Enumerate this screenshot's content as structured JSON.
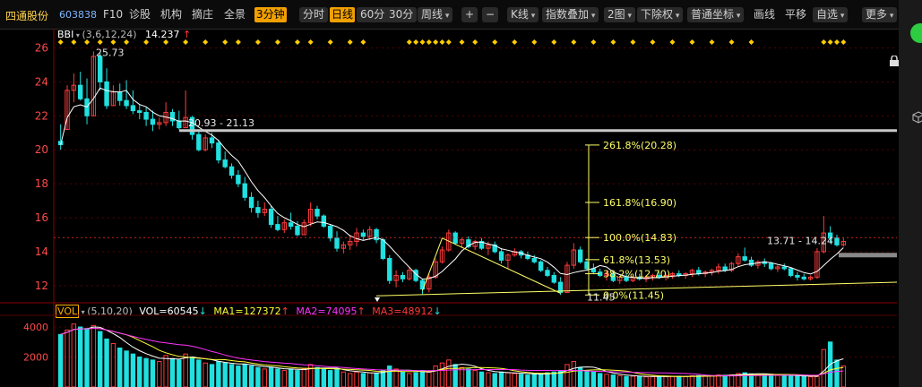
{
  "stock": {
    "name": "四通股份",
    "code": "603838"
  },
  "toolbar": {
    "left_items": [
      "F10",
      "诊股",
      "机构",
      "摘庄",
      "全景",
      "3分钟"
    ],
    "period_items": [
      "分时",
      "日线",
      "60分",
      "30分",
      "周线"
    ],
    "right_items": [
      "K线",
      "指数叠加",
      "2图",
      "下除权",
      "普通坐标",
      "画线",
      "平移",
      "自选",
      "更多"
    ],
    "plus": "+",
    "minus": "−",
    "active_left": "3分钟",
    "active_period": "日线"
  },
  "main_indicator": {
    "name": "BBI",
    "params": "(3,6,12,24)",
    "value": "14.237",
    "arrow": "↑"
  },
  "vol_indicator": {
    "name": "VOL",
    "params": "(5,10,20)",
    "vol": "VOL=60545",
    "vol_arrow": "↓",
    "ma1": "MA1=127372",
    "ma1_arrow": "↑",
    "ma2": "MA2=74095",
    "ma2_arrow": "↑",
    "ma3": "MA3=48912",
    "ma3_arrow": "↓"
  },
  "colors": {
    "up": "#ff3b3b",
    "down": "#20e0e0",
    "ma": "#ffffff",
    "fib": "#ffff66",
    "ma1": "#ffffff",
    "ma2": "#ffff33",
    "ma3": "#ff33ff",
    "grid": "#5a0000"
  },
  "icons": {
    "right_top": "green-circle-icon",
    "lock": "lock-icon",
    "cube": "cube-icon"
  },
  "chart_data": [
    {
      "type": "candlestick",
      "ylim": [
        11.2,
        26.5
      ],
      "y_ticks": [
        12,
        14,
        16,
        18,
        20,
        22,
        24,
        26
      ],
      "annotations": {
        "high": "25.73",
        "range1": "20.93 - 21.13",
        "range2": "13.71 - 14.24",
        "low": "11.45"
      },
      "fibonacci": [
        {
          "label": "261.8%(20.28)",
          "value": 20.28
        },
        {
          "label": "161.8%(16.90)",
          "value": 16.9
        },
        {
          "label": "100.0%(14.83)",
          "value": 14.83
        },
        {
          "label": "61.8%(13.53)",
          "value": 13.53
        },
        {
          "label": "38.2%(12.70)",
          "value": 12.7
        },
        {
          "label": "0.0%(11.45)",
          "value": 11.45
        }
      ],
      "candles": [
        [
          20.5,
          21.5,
          20.0,
          20.3
        ],
        [
          21.2,
          23.8,
          21.2,
          23.5
        ],
        [
          23.5,
          24.5,
          22.8,
          23.8
        ],
        [
          23.8,
          24.6,
          22.9,
          23.0
        ],
        [
          23.0,
          24.2,
          21.5,
          22.0
        ],
        [
          22.0,
          25.8,
          22.0,
          25.5
        ],
        [
          25.5,
          25.73,
          23.5,
          24.0
        ],
        [
          24.0,
          24.8,
          22.4,
          22.6
        ],
        [
          22.6,
          23.8,
          22.6,
          23.4
        ],
        [
          23.4,
          23.9,
          22.6,
          22.9
        ],
        [
          22.9,
          24.1,
          22.4,
          22.6
        ],
        [
          22.6,
          23.5,
          22.1,
          22.3
        ],
        [
          22.3,
          22.7,
          21.8,
          22.2
        ],
        [
          22.2,
          22.5,
          21.4,
          21.8
        ],
        [
          21.8,
          22.3,
          21.1,
          21.5
        ],
        [
          21.5,
          21.9,
          21.2,
          21.6
        ],
        [
          21.6,
          22.8,
          21.4,
          22.2
        ],
        [
          22.2,
          22.4,
          21.4,
          21.7
        ],
        [
          21.7,
          22.3,
          21.2,
          21.3
        ],
        [
          21.3,
          23.5,
          21.3,
          21.9
        ],
        [
          21.9,
          22.0,
          20.6,
          20.9
        ],
        [
          20.9,
          21.1,
          19.9,
          20.0
        ],
        [
          20.0,
          20.9,
          19.9,
          20.7
        ],
        [
          20.7,
          21.0,
          20.1,
          20.4
        ],
        [
          20.4,
          20.6,
          19.2,
          19.4
        ],
        [
          19.4,
          19.9,
          18.9,
          19.0
        ],
        [
          19.0,
          19.2,
          18.3,
          18.5
        ],
        [
          18.5,
          18.8,
          17.8,
          18.0
        ],
        [
          18.0,
          18.4,
          17.0,
          17.2
        ],
        [
          17.2,
          17.5,
          16.3,
          16.6
        ],
        [
          16.6,
          17.0,
          16.0,
          16.3
        ],
        [
          16.3,
          16.9,
          16.1,
          16.5
        ],
        [
          16.5,
          16.7,
          15.4,
          15.6
        ],
        [
          15.6,
          16.1,
          15.2,
          15.3
        ],
        [
          15.3,
          15.9,
          15.1,
          15.7
        ],
        [
          15.7,
          16.3,
          15.3,
          15.5
        ],
        [
          15.5,
          15.8,
          14.9,
          15.0
        ],
        [
          15.0,
          15.9,
          15.0,
          15.7
        ],
        [
          15.7,
          16.9,
          15.5,
          16.5
        ],
        [
          16.5,
          16.7,
          15.9,
          16.1
        ],
        [
          16.1,
          16.2,
          15.4,
          15.5
        ],
        [
          15.5,
          15.6,
          14.6,
          14.8
        ],
        [
          14.8,
          15.2,
          14.0,
          14.2
        ],
        [
          14.2,
          14.6,
          13.9,
          14.4
        ],
        [
          14.4,
          15.0,
          14.1,
          14.6
        ],
        [
          14.6,
          15.4,
          14.3,
          15.1
        ],
        [
          15.1,
          15.3,
          14.7,
          14.9
        ],
        [
          14.9,
          15.5,
          14.7,
          15.3
        ],
        [
          15.3,
          15.4,
          14.5,
          14.7
        ],
        [
          14.7,
          14.8,
          13.5,
          13.6
        ],
        [
          13.6,
          13.8,
          12.1,
          12.3
        ],
        [
          12.3,
          12.9,
          11.9,
          12.6
        ],
        [
          12.6,
          12.8,
          12.2,
          12.4
        ],
        [
          12.4,
          13.1,
          12.3,
          12.9
        ],
        [
          12.9,
          13.0,
          12.2,
          12.3
        ],
        [
          12.3,
          12.4,
          11.5,
          11.8
        ],
        [
          11.8,
          12.7,
          11.6,
          12.5
        ],
        [
          12.5,
          13.6,
          12.4,
          13.4
        ],
        [
          13.4,
          14.3,
          13.3,
          14.1
        ],
        [
          14.1,
          15.3,
          14.0,
          15.1
        ],
        [
          15.1,
          15.2,
          14.4,
          14.5
        ],
        [
          14.5,
          14.8,
          14.2,
          14.7
        ],
        [
          14.7,
          14.9,
          14.2,
          14.3
        ],
        [
          14.3,
          14.7,
          14.1,
          14.6
        ],
        [
          14.6,
          14.8,
          14.1,
          14.2
        ],
        [
          14.2,
          14.6,
          13.8,
          14.4
        ],
        [
          14.4,
          14.6,
          13.9,
          14.0
        ],
        [
          14.0,
          14.2,
          13.3,
          13.5
        ],
        [
          13.5,
          13.9,
          13.0,
          13.8
        ],
        [
          13.8,
          14.2,
          13.7,
          14.0
        ],
        [
          14.0,
          14.1,
          13.6,
          13.8
        ],
        [
          13.8,
          14.0,
          13.5,
          13.6
        ],
        [
          13.6,
          13.8,
          13.3,
          13.4
        ],
        [
          13.4,
          13.5,
          12.8,
          12.9
        ],
        [
          12.9,
          13.1,
          12.5,
          12.6
        ],
        [
          12.6,
          12.8,
          12.1,
          12.2
        ],
        [
          12.2,
          12.5,
          11.45,
          11.6
        ],
        [
          11.6,
          13.4,
          11.6,
          13.2
        ],
        [
          13.2,
          14.5,
          13.0,
          14.1
        ],
        [
          14.1,
          14.3,
          13.3,
          13.4
        ],
        [
          13.4,
          13.6,
          12.9,
          13.0
        ],
        [
          13.0,
          13.3,
          12.7,
          12.8
        ],
        [
          12.8,
          13.0,
          12.5,
          12.6
        ],
        [
          12.6,
          12.9,
          12.3,
          12.7
        ],
        [
          12.7,
          12.8,
          12.2,
          12.3
        ],
        [
          12.3,
          12.6,
          12.1,
          12.5
        ],
        [
          12.5,
          12.7,
          12.2,
          12.3
        ],
        [
          12.3,
          12.6,
          12.2,
          12.5
        ],
        [
          12.5,
          12.7,
          12.3,
          12.4
        ],
        [
          12.4,
          12.6,
          12.2,
          12.5
        ],
        [
          12.5,
          12.7,
          12.3,
          12.6
        ],
        [
          12.6,
          12.8,
          12.4,
          12.5
        ],
        [
          12.5,
          12.7,
          12.3,
          12.6
        ],
        [
          12.6,
          12.8,
          12.4,
          12.7
        ],
        [
          12.7,
          12.9,
          12.5,
          12.6
        ],
        [
          12.6,
          12.8,
          12.4,
          12.7
        ],
        [
          12.7,
          13.0,
          12.5,
          12.9
        ],
        [
          12.9,
          13.1,
          12.6,
          12.7
        ],
        [
          12.7,
          12.9,
          12.5,
          12.8
        ],
        [
          12.8,
          13.0,
          12.6,
          12.9
        ],
        [
          12.9,
          13.3,
          12.7,
          13.1
        ],
        [
          13.1,
          13.3,
          12.8,
          12.9
        ],
        [
          12.9,
          13.4,
          12.8,
          13.3
        ],
        [
          13.3,
          13.9,
          13.1,
          13.7
        ],
        [
          13.7,
          14.24,
          13.4,
          13.5
        ],
        [
          13.5,
          13.7,
          13.1,
          13.2
        ],
        [
          13.2,
          13.5,
          13.0,
          13.4
        ],
        [
          13.4,
          13.6,
          13.1,
          13.3
        ],
        [
          13.3,
          13.4,
          12.9,
          13.0
        ],
        [
          13.0,
          13.2,
          12.8,
          13.1
        ],
        [
          13.1,
          13.3,
          12.9,
          13.0
        ],
        [
          13.0,
          13.1,
          12.5,
          12.6
        ],
        [
          12.6,
          12.8,
          12.3,
          12.5
        ],
        [
          12.5,
          12.7,
          12.3,
          12.4
        ],
        [
          12.4,
          12.6,
          12.3,
          12.5
        ],
        [
          12.5,
          14.2,
          12.4,
          14.0
        ],
        [
          14.0,
          16.1,
          13.9,
          15.1
        ],
        [
          15.1,
          15.5,
          14.5,
          14.8
        ],
        [
          14.8,
          15.0,
          14.3,
          14.4
        ],
        [
          14.4,
          14.8,
          14.3,
          14.6
        ]
      ],
      "volumes": [
        3500,
        3800,
        4200,
        4000,
        3900,
        4100,
        3700,
        3200,
        2900,
        2600,
        2400,
        2200,
        2000,
        1900,
        1800,
        1700,
        2100,
        1900,
        1800,
        2200,
        2000,
        1800,
        1600,
        1500,
        1700,
        1600,
        1500,
        1400,
        1500,
        1400,
        1300,
        1200,
        1300,
        1200,
        1100,
        1200,
        1100,
        1200,
        1500,
        1300,
        1200,
        1100,
        1200,
        1000,
        900,
        1000,
        900,
        950,
        900,
        1100,
        1400,
        1200,
        1000,
        900,
        950,
        1100,
        1000,
        1400,
        1600,
        1800,
        1500,
        1300,
        1200,
        1100,
        1000,
        950,
        900,
        1000,
        950,
        900,
        850,
        800,
        850,
        900,
        950,
        1000,
        1100,
        1500,
        1700,
        1300,
        1100,
        1000,
        900,
        850,
        800,
        750,
        700,
        720,
        700,
        680,
        700,
        690,
        700,
        710,
        720,
        700,
        750,
        760,
        740,
        760,
        800,
        780,
        820,
        900,
        950,
        880,
        850,
        820,
        800,
        780,
        760,
        740,
        720,
        700,
        680,
        700,
        2500,
        3000,
        1800,
        1400,
        1200
      ]
    }
  ]
}
